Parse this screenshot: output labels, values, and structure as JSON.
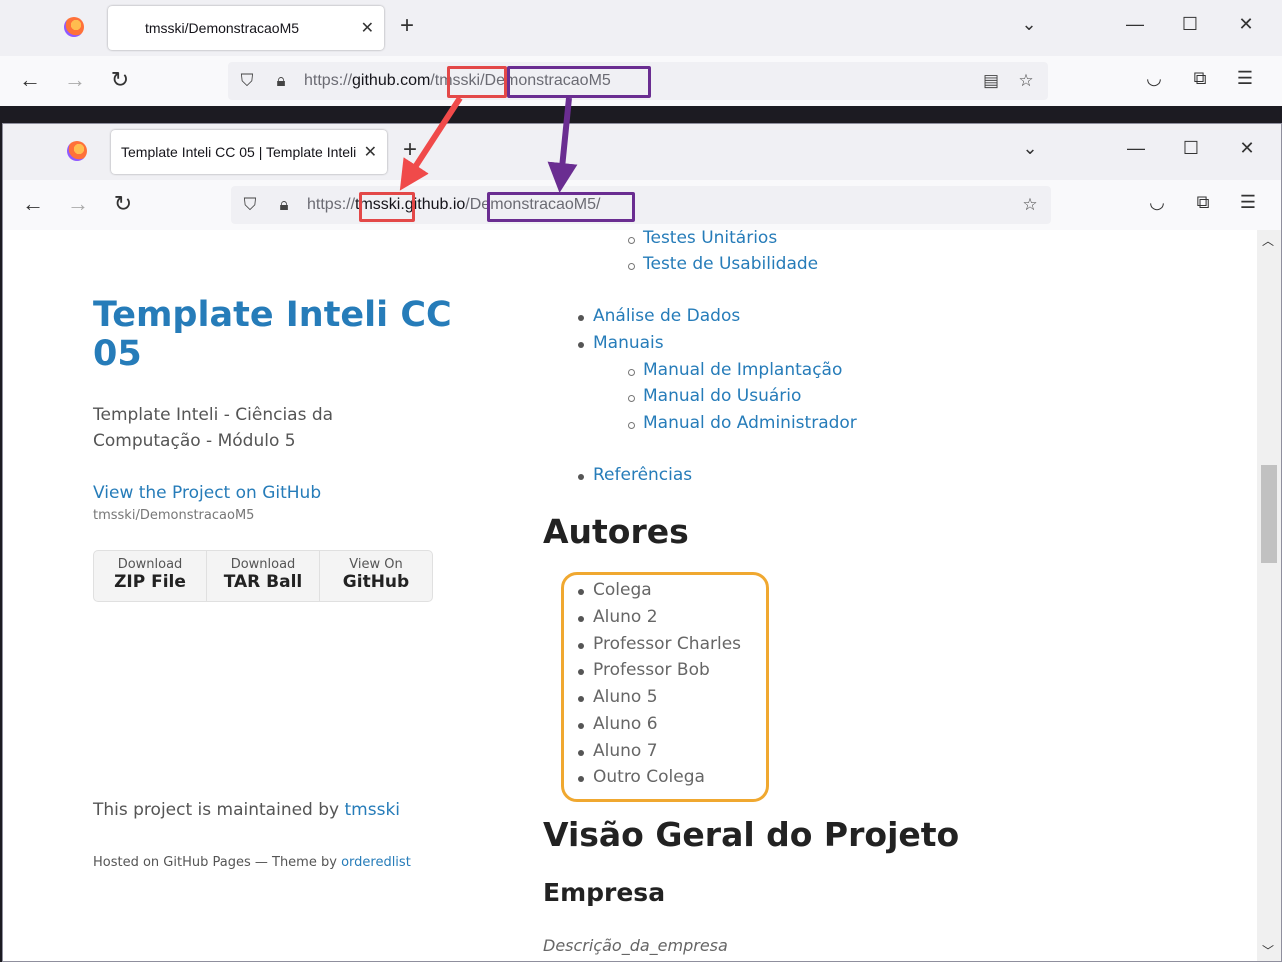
{
  "back_window": {
    "tab_title": "tmsski/DemonstracaoM5",
    "url_prefix": "https://",
    "url_host": "github.com",
    "url_slash1": "/",
    "url_user": "tmsski",
    "url_slash2": "/",
    "url_repo": "DemonstracaoM5"
  },
  "front_window": {
    "tab_title": "Template Inteli CC 05 | Template Inteli",
    "url_prefix": "https://",
    "url_user": "tmsski",
    "url_host": ".github.io",
    "url_slash1": "/",
    "url_repo": "DemonstracaoM5",
    "url_slash2": "/"
  },
  "sidebar": {
    "title": "Template Inteli CC 05",
    "tagline": "Template Inteli - Ciências da Computação - Módulo 5",
    "github_link": "View the Project on GitHub",
    "github_sub": "tmsski/DemonstracaoM5",
    "downloads": [
      {
        "small": "Download",
        "big": "ZIP File"
      },
      {
        "small": "Download",
        "big": "TAR Ball"
      },
      {
        "small": "View On",
        "big": "GitHub"
      }
    ],
    "maintained_text": "This project is maintained by ",
    "maintained_link": "tmsski",
    "hosted_text": "Hosted on GitHub Pages — Theme by ",
    "hosted_link": "orderedlist"
  },
  "toc": {
    "sub_items_top": [
      "Testes Unitários",
      "Teste de Usabilidade"
    ],
    "item_analise": "Análise de Dados",
    "item_manuais": "Manuais",
    "manuais_sub": [
      "Manual de Implantação",
      "Manual do Usuário",
      "Manual do Administrador"
    ],
    "item_referencias": "Referências"
  },
  "main": {
    "autores_heading": "Autores",
    "autores": [
      "Colega",
      "Aluno 2",
      "Professor Charles",
      "Professor Bob",
      "Aluno 5",
      "Aluno 6",
      "Aluno 7",
      "Outro Colega"
    ],
    "visao_heading": "Visão Geral do Projeto",
    "empresa_heading": "Empresa",
    "empresa_desc": "Descrição_da_empresa"
  },
  "colors": {
    "link": "#267cb9",
    "highlight_red": "#e34848",
    "highlight_purple": "#6a2d91",
    "highlight_orange": "#f0a830"
  }
}
